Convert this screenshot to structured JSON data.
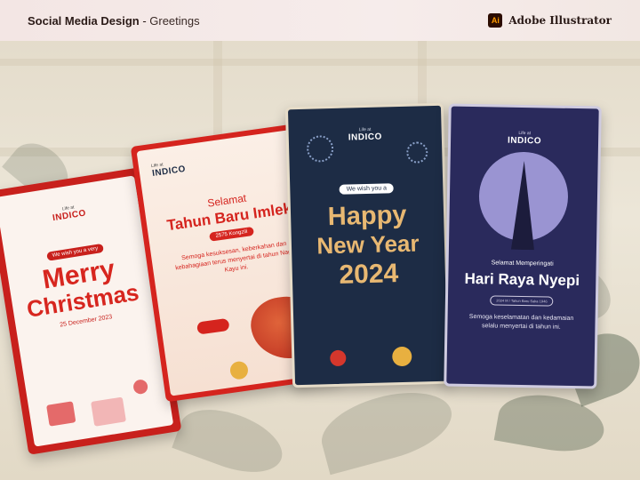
{
  "header": {
    "title_bold": "Social Media Design",
    "title_sep": " - ",
    "title_rest": "Greetings",
    "app_icon": "Ai",
    "app_name": "Adobe Illustrator"
  },
  "cards": {
    "christmas": {
      "brand_small": "Life at",
      "brand": "INDICO",
      "pill": "We wish you a very",
      "line1": "Merry",
      "line2": "Christmas",
      "date": "25 December 2023"
    },
    "imlek": {
      "brand_small": "Life at",
      "brand": "INDICO",
      "greeting": "Selamat",
      "title": "Tahun Baru Imlek",
      "badge": "2575 Kongzili",
      "body": "Semoga kesuksesan, keberkahan dan kebahagiaan terus menyertai di tahun Naga Kayu ini."
    },
    "newyear": {
      "brand_small": "Life at",
      "brand": "INDICO",
      "pill": "We wish you a",
      "line1": "Happy",
      "line2": "New Year",
      "line3": "2024"
    },
    "nyepi": {
      "brand_small": "Life at",
      "brand": "INDICO",
      "greeting": "Selamat Memperingati",
      "title": "Hari Raya Nyepi",
      "badge": "2024 M / Tahun Baru Saka 1946",
      "body": "Semoga keselamatan dan kedamaian selalu menyertai di tahun ini."
    }
  },
  "colors": {
    "christmas_red": "#c8201c",
    "imlek_red": "#d5241e",
    "newyear_navy": "#1d2c45",
    "nyepi_purple": "#2a2a5c",
    "gold": "#e8b872"
  }
}
